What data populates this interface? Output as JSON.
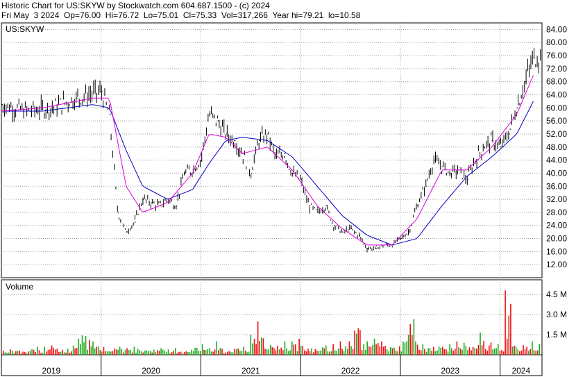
{
  "header": {
    "line1": "Historic Chart for US:SKYW by Stockwatch.com 604.687.1500 - (c) 2024",
    "line2": "Fri May  3 2024  Op=76.00  Hi=76.72  Lo=75.01  Cl=75.33  Vol=317,266  Year hi=79.21  lo=10.58"
  },
  "price_panel": {
    "label": "US:SKYW"
  },
  "volume_panel": {
    "label": "Volume"
  },
  "colors": {
    "price": "#000000",
    "ma_short": "#e000e0",
    "ma_long": "#0000c0",
    "volume_up": "#22aa22",
    "volume_down": "#ee1111",
    "grid": "#a0a0a0",
    "frame": "#000000"
  },
  "chart_data": [
    {
      "type": "line",
      "title": "US:SKYW",
      "ylim": [
        8,
        86
      ],
      "y_ticks": [
        84,
        80,
        76,
        72,
        68,
        64,
        60,
        56,
        52,
        48,
        44,
        40,
        36,
        32,
        28,
        24,
        20,
        16,
        12
      ],
      "y_tick_labels": [
        "84.00",
        "80.00",
        "76.00",
        "72.00",
        "68.00",
        "64.00",
        "60.00",
        "56.00",
        "52.00",
        "48.00",
        "44.00",
        "40.00",
        "36.00",
        "32.00",
        "28.00",
        "24.00",
        "20.00",
        "16.00",
        "12.00"
      ],
      "x_tick_labels": [
        "2019",
        "2020",
        "2021",
        "2022",
        "2023",
        "2024"
      ],
      "grid": true,
      "series": [
        {
          "role": "close",
          "x": [
            "2019-01",
            "2019-04",
            "2019-07",
            "2019-10",
            "2020-01",
            "2020-02",
            "2020-03",
            "2020-04",
            "2020-05",
            "2020-06",
            "2020-07",
            "2020-08",
            "2020-09",
            "2020-10",
            "2020-11",
            "2020-12",
            "2021-01",
            "2021-02",
            "2021-03",
            "2021-04",
            "2021-05",
            "2021-06",
            "2021-07",
            "2021-08",
            "2021-09",
            "2021-10",
            "2021-11",
            "2021-12",
            "2022-01",
            "2022-02",
            "2022-03",
            "2022-04",
            "2022-05",
            "2022-06",
            "2022-07",
            "2022-08",
            "2022-09",
            "2022-10",
            "2022-11",
            "2022-12",
            "2023-01",
            "2023-02",
            "2023-03",
            "2023-04",
            "2023-05",
            "2023-06",
            "2023-07",
            "2023-08",
            "2023-09",
            "2023-10",
            "2023-11",
            "2023-12",
            "2024-01",
            "2024-02",
            "2024-03",
            "2024-04",
            "2024-05"
          ],
          "y": [
            61,
            59,
            60,
            63,
            65,
            58,
            28,
            22,
            25,
            32,
            31,
            30,
            32,
            30,
            40,
            41,
            44,
            58,
            56,
            52,
            50,
            46,
            40,
            50,
            52,
            45,
            46,
            40,
            38,
            30,
            28,
            30,
            24,
            22,
            23,
            21,
            17,
            17,
            18,
            18,
            20,
            22,
            30,
            36,
            44,
            42,
            40,
            41,
            38,
            44,
            48,
            50,
            48,
            52,
            60,
            68,
            75.33
          ]
        },
        {
          "role": "moving-average-short",
          "x": [
            "2019-01",
            "2019-06",
            "2019-12",
            "2020-02",
            "2020-04",
            "2020-06",
            "2020-09",
            "2020-12",
            "2021-02",
            "2021-04",
            "2021-06",
            "2021-09",
            "2021-12",
            "2022-03",
            "2022-06",
            "2022-09",
            "2022-12",
            "2023-03",
            "2023-06",
            "2023-09",
            "2023-12",
            "2024-03",
            "2024-05"
          ],
          "y": [
            59,
            60,
            63,
            63,
            36,
            28,
            31,
            40,
            52,
            51,
            46,
            48,
            41,
            30,
            23,
            18,
            18,
            26,
            41,
            41,
            48,
            58,
            70
          ]
        },
        {
          "role": "moving-average-long",
          "x": [
            "2019-01",
            "2019-06",
            "2019-12",
            "2020-02",
            "2020-04",
            "2020-06",
            "2020-09",
            "2020-12",
            "2021-02",
            "2021-04",
            "2021-06",
            "2021-09",
            "2021-12",
            "2022-03",
            "2022-06",
            "2022-09",
            "2022-12",
            "2023-03",
            "2023-06",
            "2023-09",
            "2023-12",
            "2024-03",
            "2024-05"
          ],
          "y": [
            59,
            59,
            61,
            60,
            47,
            36,
            32,
            35,
            43,
            50,
            51,
            50,
            45,
            36,
            27,
            21,
            18,
            20,
            30,
            39,
            45,
            52,
            62
          ]
        }
      ]
    },
    {
      "type": "bar",
      "title": "Volume",
      "ylim": [
        0,
        5.6
      ],
      "y_ticks": [
        4.5,
        3.0,
        1.5
      ],
      "y_tick_labels": [
        "4.5 M",
        "3.0 M",
        "1.5 M"
      ],
      "unit": "M",
      "series": [
        {
          "name": "daily",
          "values": [
            0.3,
            0.4,
            0.5,
            0.4,
            0.6,
            0.5,
            0.6,
            0.7,
            0.6,
            0.6,
            1.2,
            2.0,
            1.4,
            1.0,
            0.8,
            0.7,
            0.6,
            0.6,
            0.5,
            0.6,
            0.5,
            0.6,
            0.5,
            0.5,
            0.4,
            0.5,
            0.5,
            0.7,
            0.8,
            0.6,
            0.5,
            1.0,
            0.5,
            0.6,
            0.6,
            0.6,
            1.5,
            2.5,
            1.0,
            1.0,
            1.0,
            0.8,
            1.0,
            1.2,
            0.8,
            0.6,
            0.7,
            0.7,
            0.8,
            1.0,
            1.5,
            3.5,
            1.0,
            1.0,
            1.2,
            1.0,
            0.8,
            0.9,
            1.5,
            3.4,
            1.0,
            0.8,
            1.0,
            0.9,
            0.8,
            0.7,
            1.0,
            0.9,
            0.8,
            2.3,
            0.9,
            1.0,
            0.8,
            4.8,
            0.9,
            0.9,
            1.0,
            0.9,
            0.8
          ]
        }
      ]
    }
  ]
}
